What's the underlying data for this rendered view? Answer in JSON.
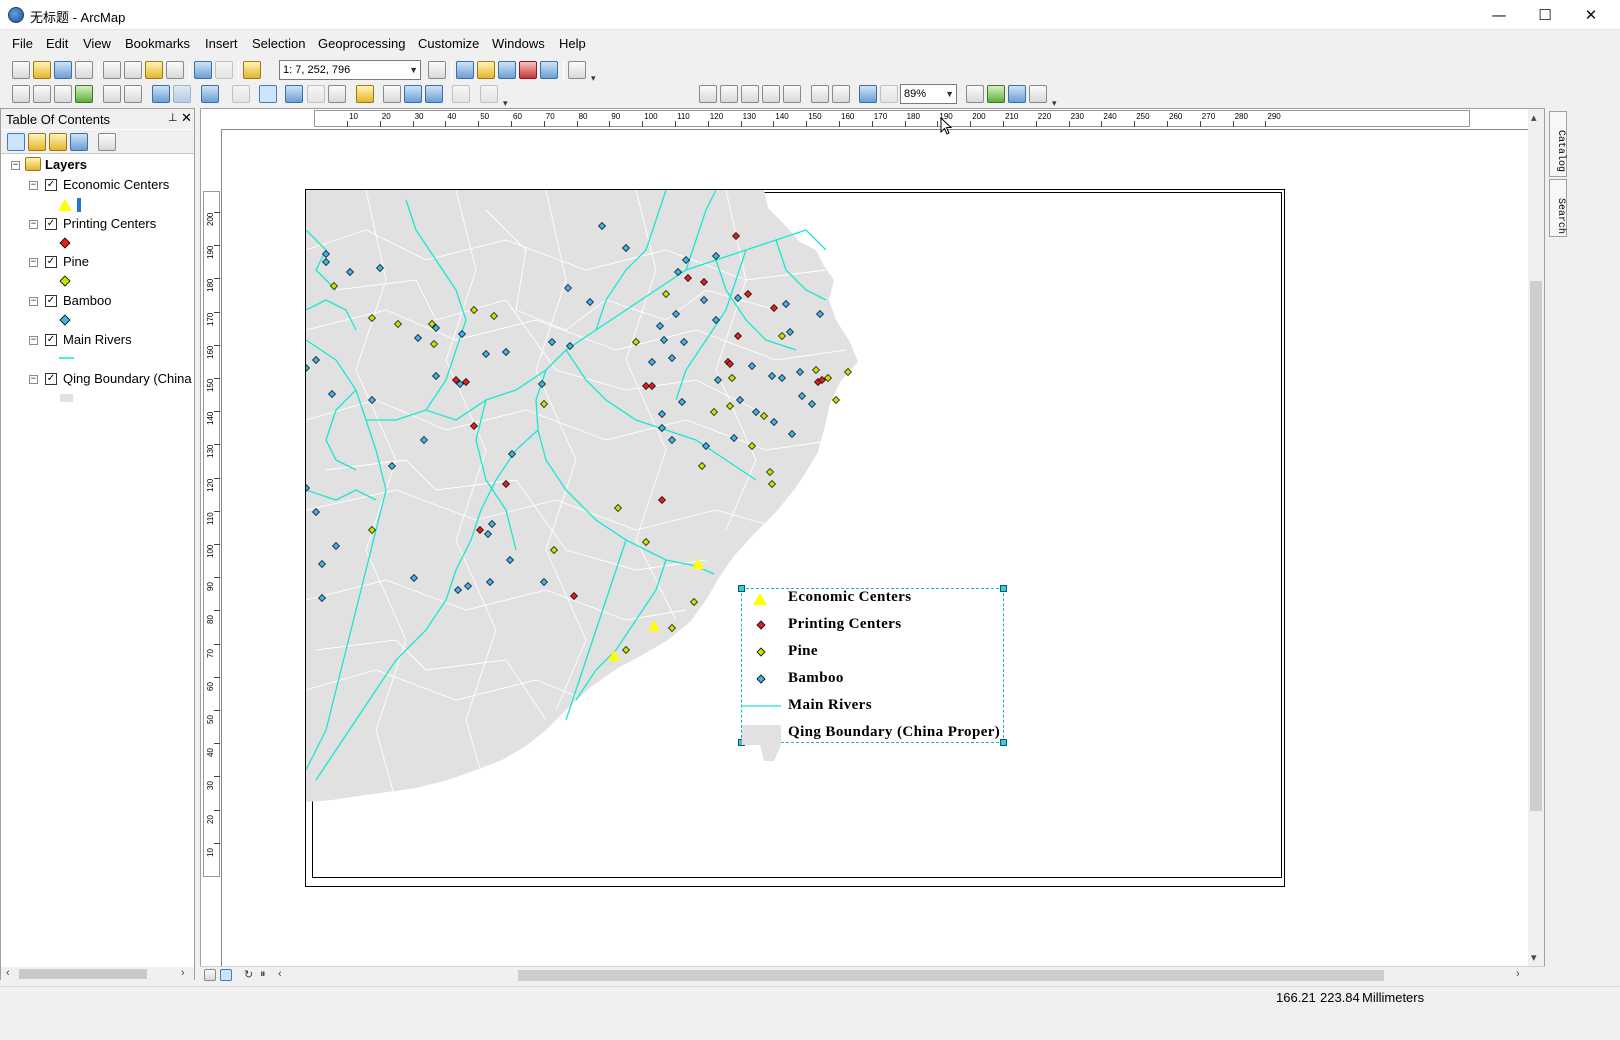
{
  "window": {
    "title": "无标题 - ArcMap",
    "minimize_glyph": "—",
    "maximize_glyph": "☐",
    "close_glyph": "✕"
  },
  "menu": [
    "File",
    "Edit",
    "View",
    "Bookmarks",
    "Insert",
    "Selection",
    "Geoprocessing",
    "Customize",
    "Windows",
    "Help"
  ],
  "toolbar": {
    "scale_value": "1: 7, 252, 796",
    "zoom_value": "89%"
  },
  "toc": {
    "title": "Table Of Contents",
    "pin_glyph": "📌",
    "close_glyph": "✕",
    "root_label": "Layers",
    "layers": [
      {
        "label": "Economic Centers",
        "checked": true,
        "symbol": "yellow-triangle"
      },
      {
        "label": "Printing Centers",
        "checked": true,
        "symbol": "red-point"
      },
      {
        "label": "Pine",
        "checked": true,
        "symbol": "yellow-green-point"
      },
      {
        "label": "Bamboo",
        "checked": true,
        "symbol": "blue-point"
      },
      {
        "label": "Main Rivers",
        "checked": true,
        "symbol": "cyan-line"
      },
      {
        "label": "Qing Boundary (China",
        "checked": true,
        "symbol": "gray-polygon"
      }
    ]
  },
  "rulers": {
    "horizontal": [
      "10",
      "20",
      "30",
      "40",
      "50",
      "60",
      "70",
      "80",
      "90",
      "100",
      "110",
      "120",
      "130",
      "140",
      "150",
      "160",
      "170",
      "180",
      "190",
      "200",
      "210",
      "220",
      "230",
      "240",
      "250",
      "260",
      "270",
      "280",
      "290"
    ],
    "vertical": [
      "200",
      "190",
      "180",
      "170",
      "160",
      "150",
      "140",
      "130",
      "120",
      "110",
      "100",
      "90",
      "80",
      "70",
      "60",
      "50",
      "40",
      "30",
      "20",
      "10"
    ]
  },
  "legend": {
    "items": [
      {
        "label": "Economic Centers",
        "symbol": "triangle"
      },
      {
        "label": "Printing Centers",
        "symbol": "red-point"
      },
      {
        "label": "Pine",
        "symbol": "yellow-green-point"
      },
      {
        "label": "Bamboo",
        "symbol": "blue-point"
      },
      {
        "label": "Main Rivers",
        "symbol": "line"
      },
      {
        "label": "Qing Boundary (China Proper)",
        "symbol": "polygon"
      }
    ]
  },
  "colors": {
    "land": "#e1e1e1",
    "river": "#19e6d2",
    "boundary": "#ffffff",
    "economic": "#ffff00",
    "printing": "#e02020",
    "pine": "#c8e000",
    "bamboo": "#3cb4e6"
  },
  "side_tabs": [
    "Catalog",
    "Search"
  ],
  "status": {
    "x": "166.21",
    "y": "223.84",
    "units": "Millimeters"
  }
}
